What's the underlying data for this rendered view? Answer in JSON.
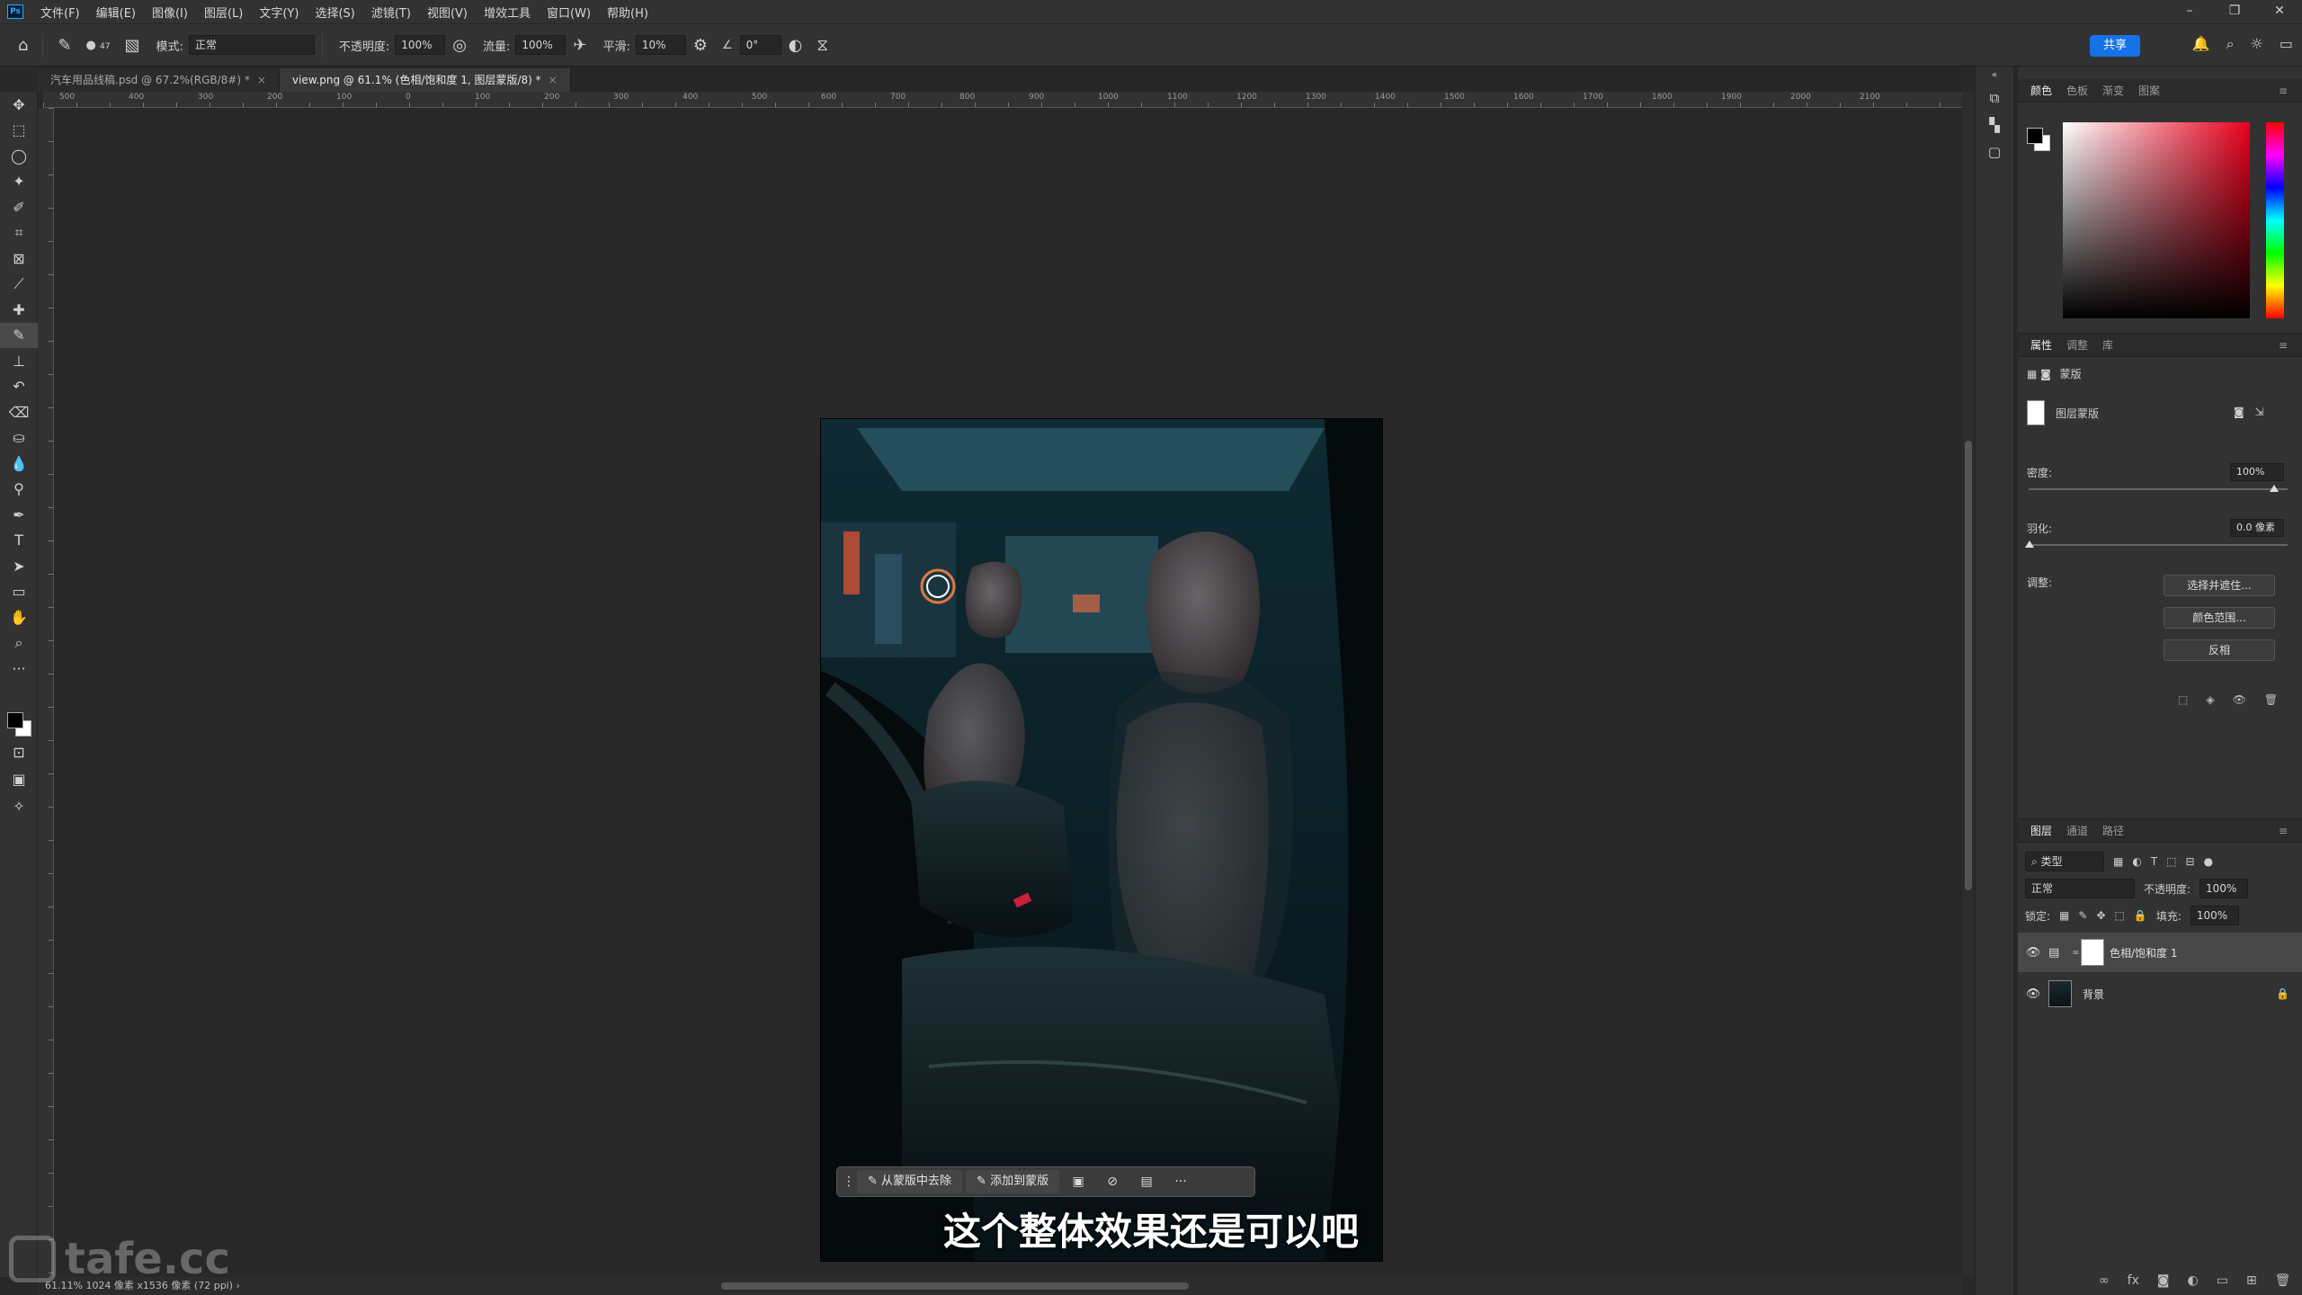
{
  "menubar": {
    "logo": "Ps",
    "items": [
      "文件(F)",
      "编辑(E)",
      "图像(I)",
      "图层(L)",
      "文字(Y)",
      "选择(S)",
      "滤镜(T)",
      "视图(V)",
      "增效工具",
      "窗口(W)",
      "帮助(H)"
    ],
    "window_controls": [
      "–",
      "❐",
      "✕"
    ]
  },
  "optbar": {
    "brush_size": "47",
    "mode_label": "模式:",
    "mode_value": "正常",
    "opacity_label": "不透明度:",
    "opacity_value": "100%",
    "flow_label": "流量:",
    "flow_value": "100%",
    "smoothing_label": "平滑:",
    "smoothing_value": "10%",
    "angle_value": "0°",
    "share_label": "共享"
  },
  "tabs": [
    {
      "label": "汽车用品线稿.psd @ 67.2%(RGB/8#) *",
      "active": false
    },
    {
      "label": "view.png @ 61.1% (色相/饱和度 1, 图层蒙版/8) *",
      "active": true
    }
  ],
  "ruler_top": [
    "500",
    "400",
    "300",
    "200",
    "100",
    "0",
    "100",
    "200",
    "300",
    "400",
    "500",
    "600",
    "700",
    "800",
    "900",
    "1000",
    "1100",
    "1200",
    "1300",
    "1400",
    "1500",
    "1600",
    "1700",
    "1800",
    "1900",
    "2000",
    "2100"
  ],
  "statusbar": {
    "text": "61.11%   1024 像素 x1536 像素 (72 ppi)   ›"
  },
  "taskbar": {
    "subtract_label": "从蒙版中去除",
    "add_label": "添加到蒙版",
    "more_label": "···"
  },
  "subtitle": "这个整体效果还是可以吧",
  "watermark": "tafe.cc",
  "panels": {
    "color_tabs": [
      "颜色",
      "色板",
      "渐变",
      "图案"
    ],
    "props_tabs": [
      "属性",
      "调整",
      "库"
    ],
    "mask_label": "蒙版",
    "layer_mask_label": "图层蒙版",
    "density_label": "密度:",
    "density_value": "100%",
    "feather_label": "羽化:",
    "feather_value": "0.0 像素",
    "adjust_label": "调整:",
    "select_mask_btn": "选择并遮住...",
    "color_range_btn": "颜色范围...",
    "invert_btn": "反相",
    "layers_tabs": [
      "图层",
      "通道",
      "路径"
    ],
    "filter_kind": "类型",
    "blend_mode": "正常",
    "opacity_label": "不透明度:",
    "opacity_value": "100%",
    "lock_label": "锁定:",
    "fill_label": "填充:",
    "fill_value": "100%",
    "layers": [
      {
        "name": "色相/饱和度 1",
        "selected": true
      },
      {
        "name": "背景",
        "selected": false
      }
    ]
  },
  "colors": {
    "accent": "#1473e6",
    "chrome": "#323232",
    "canvas_bg": "#282828"
  }
}
